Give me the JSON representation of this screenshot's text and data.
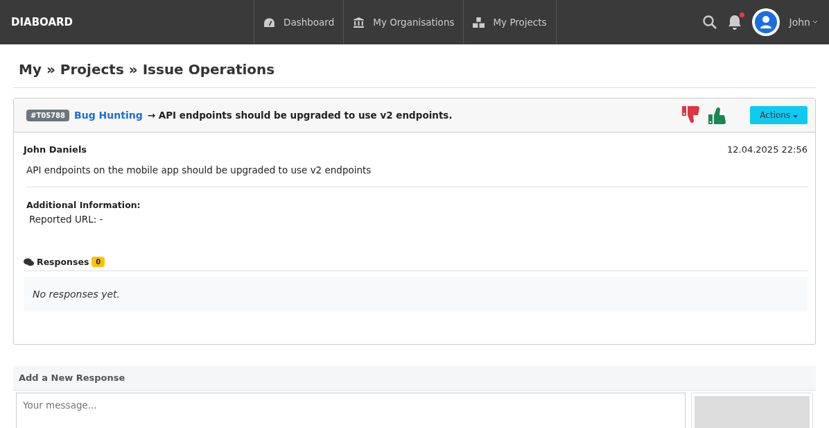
{
  "navbar": {
    "brand": "DIABOARD",
    "items": [
      {
        "label": "Dashboard",
        "kind": "gauge"
      },
      {
        "label": "My Organisations",
        "kind": "bank"
      },
      {
        "label": "My Projects",
        "kind": "boxes"
      }
    ],
    "notifications_unread": true,
    "user": "John"
  },
  "breadcrumb": "My » Projects » Issue Operations",
  "issue": {
    "id": "#T05788",
    "project": "Bug Hunting",
    "arrow": "→",
    "title": "API endpoints should be upgraded to use v2 endpoints.",
    "actions_button": "Actions",
    "author": "John Daniels",
    "date": "12.04.2025 22:56",
    "description": "API endpoints on the mobile app should be upgraded to use v2 endpoints",
    "additional_info_title": "Additional Information:",
    "reported_url": "Reported URL: -",
    "responses_title": "Responses",
    "responses_count": "0",
    "empty_message": "No responses yet."
  },
  "new_response": {
    "title": "Add a New Response",
    "placeholder": "Your message..."
  }
}
